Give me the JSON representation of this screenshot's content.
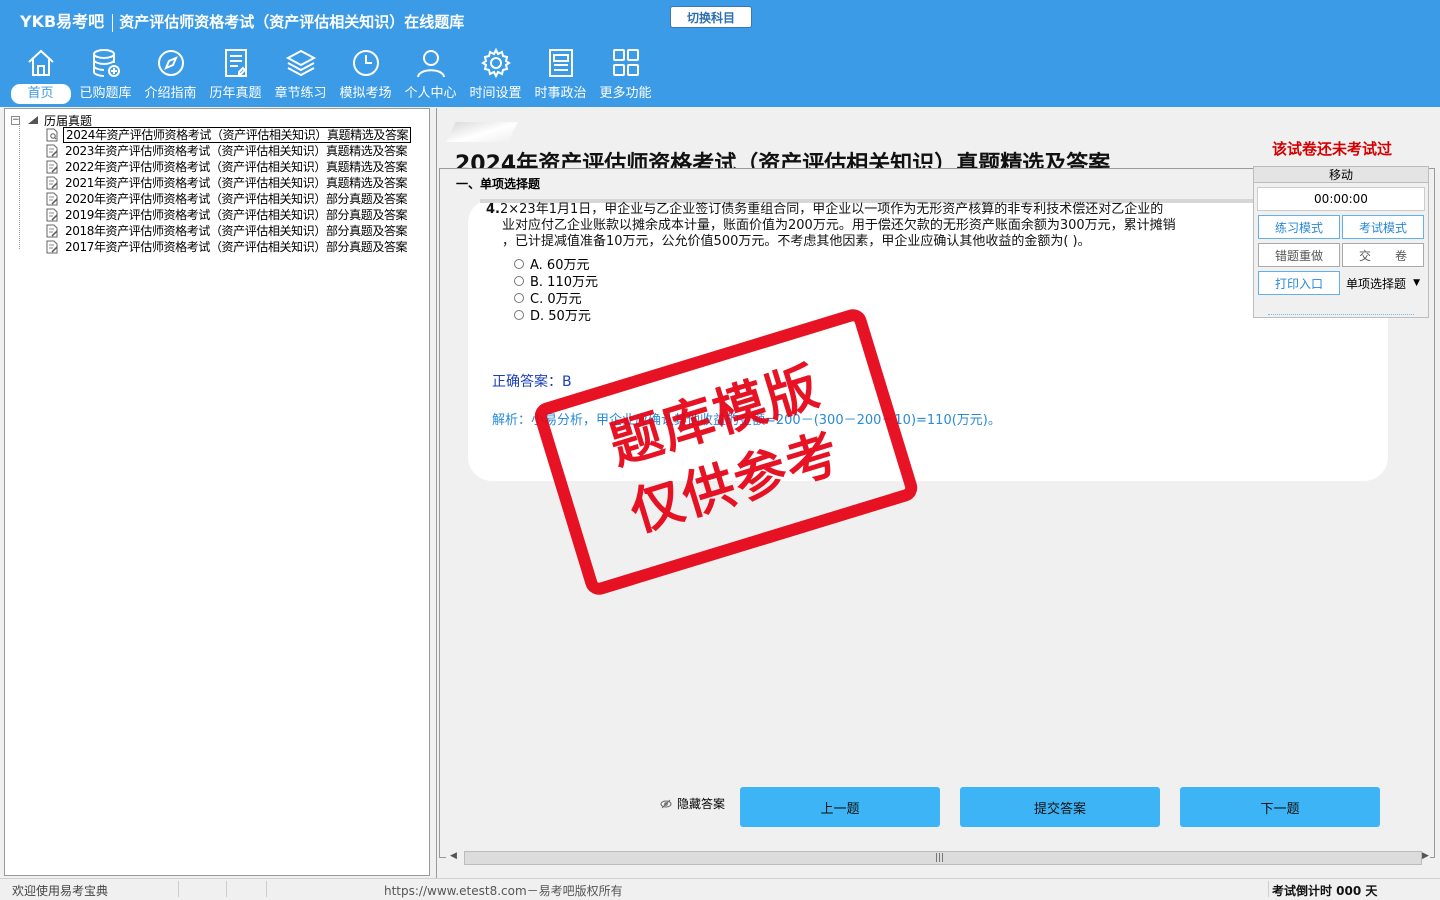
{
  "header": {
    "brand": "YKB易考吧",
    "subtitle": "资产评估师资格考试（资产评估相关知识）在线题库",
    "switch_label": "切换科目"
  },
  "nav": [
    {
      "label": "首页",
      "icon": "home-icon"
    },
    {
      "label": "已购题库",
      "icon": "database-icon"
    },
    {
      "label": "介绍指南",
      "icon": "compass-icon"
    },
    {
      "label": "历年真题",
      "icon": "document-icon"
    },
    {
      "label": "章节练习",
      "icon": "layers-icon"
    },
    {
      "label": "模拟考场",
      "icon": "clock-icon"
    },
    {
      "label": "个人中心",
      "icon": "user-icon"
    },
    {
      "label": "时间设置",
      "icon": "gear-icon"
    },
    {
      "label": "时事政治",
      "icon": "news-icon"
    },
    {
      "label": "更多功能",
      "icon": "grid-icon"
    }
  ],
  "tree": {
    "root": "历届真题",
    "items": [
      "2024年资产评估师资格考试（资产评估相关知识）真题精选及答案",
      "2023年资产评估师资格考试（资产评估相关知识）真题精选及答案",
      "2022年资产评估师资格考试（资产评估相关知识）真题精选及答案",
      "2021年资产评估师资格考试（资产评估相关知识）真题精选及答案",
      "2020年资产评估师资格考试（资产评估相关知识）部分真题及答案",
      "2019年资产评估师资格考试（资产评估相关知识）部分真题及答案",
      "2018年资产评估师资格考试（资产评估相关知识）部分真题及答案",
      "2017年资产评估师资格考试（资产评估相关知识）部分真题及答案"
    ]
  },
  "exam": {
    "title": "2024年资产评估师资格考试（资产评估相关知识）真题精选及答案",
    "status": "该试卷还未考试过",
    "section": "一、单项选择题",
    "question": {
      "number": "4.",
      "line1": "2×23年1月1日，甲企业与乙企业签订债务重组合同，甲企业以一项作为无形资产核算的非专利技术偿还对乙企业的",
      "line2": "业对应付乙企业账款以摊余成本计量，账面价值为200万元。用于偿还欠款的无形资产账面余额为300万元，累计摊销",
      "line3": "，已计提减值准备10万元，公允价值500万元。不考虑其他因素，甲企业应确认其他收益的金额为( )。",
      "options": [
        "A. 60万元",
        "B. 110万元",
        "C. 0万元",
        "D. 50万元"
      ],
      "answer": "正确答案：B",
      "analysis": "解析：小易分析，甲企业应确认其他收益的金额=200－(300－200－10)=110(万元)。"
    }
  },
  "controls": {
    "hide_answer": "隐藏答案",
    "prev": "上一题",
    "submit": "提交答案",
    "next": "下一题"
  },
  "float_panel": {
    "title": "移动",
    "timer": "00:00:00",
    "practice": "练习模式",
    "exam_mode": "考试模式",
    "redo_wrong": "错题重做",
    "hand_in": "交　　卷",
    "print": "打印入口",
    "type_select": "单项选择题"
  },
  "watermark": {
    "line1": "题库模版",
    "line2": "仅供参考"
  },
  "status": {
    "welcome": "欢迎使用易考宝典",
    "copyright": "https://www.etest8.com－易考吧版权所有",
    "countdown": "考试倒计时 000 天"
  },
  "colors": {
    "header_bg": "#3c9be6",
    "button_blue": "#3cb4f5",
    "status_red": "#d40000",
    "stamp_red": "#e60012"
  }
}
